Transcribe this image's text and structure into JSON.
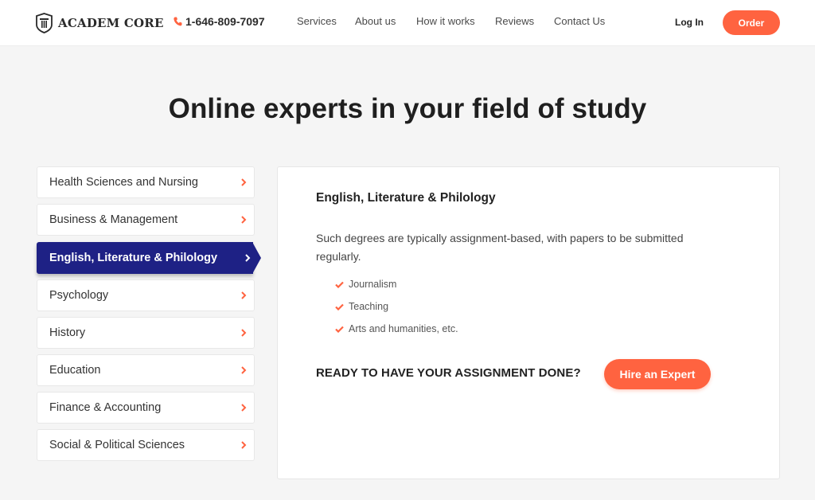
{
  "header": {
    "logo_text": "ACADEM CORE",
    "logo_icon": "pillar-shield-icon",
    "phone": "1-646-809-7097",
    "phone_icon": "phone-icon",
    "nav": [
      {
        "label": "Services"
      },
      {
        "label": "About us"
      },
      {
        "label": "How it works"
      },
      {
        "label": "Reviews"
      },
      {
        "label": "Contact Us"
      }
    ],
    "login_label": "Log In",
    "order_label": "Order"
  },
  "headline": "Online experts in your field of study",
  "categories": [
    {
      "label": "Health Sciences and Nursing",
      "active": false
    },
    {
      "label": "Business & Management",
      "active": false
    },
    {
      "label": "English, Literature & Philology",
      "active": true
    },
    {
      "label": "Psychology",
      "active": false
    },
    {
      "label": "History",
      "active": false
    },
    {
      "label": "Education",
      "active": false
    },
    {
      "label": "Finance & Accounting",
      "active": false
    },
    {
      "label": "Social & Political Sciences",
      "active": false
    }
  ],
  "panel": {
    "title": "English, Literature & Philology",
    "description": "Such degrees are typically assignment-based, with papers to be submitted regularly.",
    "items": [
      {
        "label": "Journalism"
      },
      {
        "label": "Teaching"
      },
      {
        "label": "Arts and humanities, etc."
      }
    ],
    "cta_text": "READY TO HAVE YOUR ASSIGNMENT DONE?",
    "cta_button": "Hire an Expert"
  },
  "colors": {
    "accent": "#ff6340",
    "active_bg": "#1e2185",
    "page_bg": "#f5f5f5",
    "text": "#2b2b2b"
  }
}
